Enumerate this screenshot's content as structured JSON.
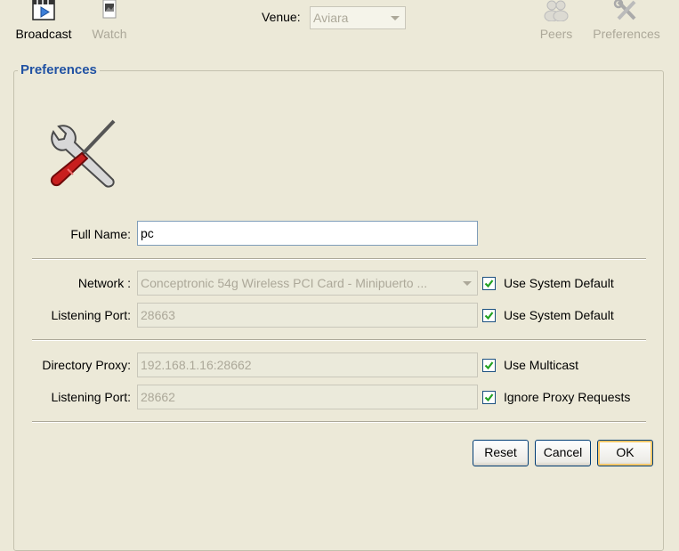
{
  "toolbar": {
    "broadcast_label": "Broadcast",
    "watch_label": "Watch",
    "venue_label": "Venue:",
    "venue_value": "Aviara",
    "peers_label": "Peers",
    "preferences_label": "Preferences"
  },
  "panel": {
    "title": "Preferences",
    "full_name_label": "Full Name:",
    "full_name_value": "pc",
    "network_label": "Network :",
    "network_value": "Conceptronic 54g Wireless PCI Card - Minipuerto ...",
    "network_default_label": "Use System Default",
    "listening_port_label": "Listening Port:",
    "listening_port_value": "28663",
    "listening_port_default_label": "Use System Default",
    "proxy_label": "Directory Proxy:",
    "proxy_value": "192.168.1.16:28662",
    "proxy_multicast_label": "Use Multicast",
    "proxy_port_label": "Listening Port:",
    "proxy_port_value": "28662",
    "ignore_proxy_label": "Ignore Proxy Requests"
  },
  "buttons": {
    "reset": "Reset",
    "cancel": "Cancel",
    "ok": "OK"
  },
  "icons": {
    "broadcast": "broadcast-icon",
    "watch": "watch-icon",
    "peers": "peers-icon",
    "preferences": "tools-icon"
  }
}
